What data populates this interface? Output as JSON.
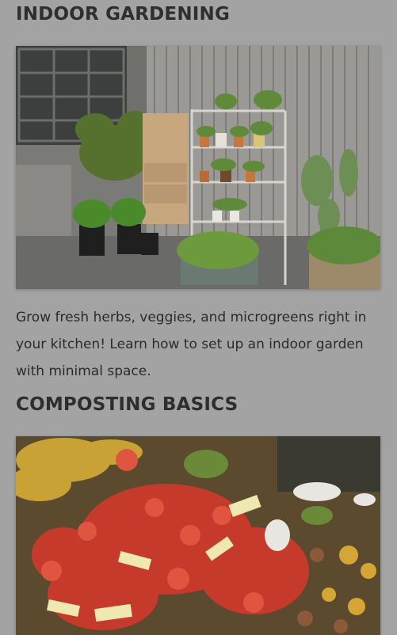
{
  "sections": [
    {
      "title": "INDOOR GARDENING",
      "image_subject": "indoor-garden-photo",
      "body": "Grow fresh herbs, veggies, and microgreens right in your kitchen! Learn how to set up an indoor garden with minimal space."
    },
    {
      "title": "COMPOSTING BASICS",
      "image_subject": "compost-pile-photo",
      "body": ""
    }
  ],
  "colors": {
    "background": "#a3a3a3",
    "text": "#2b2b2b"
  }
}
